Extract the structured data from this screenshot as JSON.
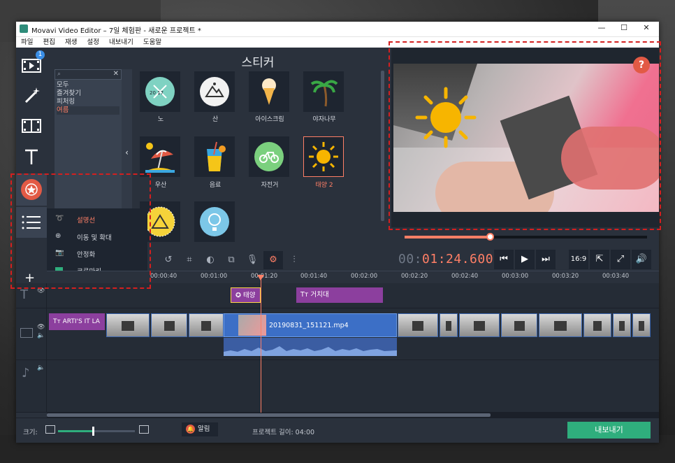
{
  "window": {
    "title": "Movavi Video Editor – 7일 체험판 - 새로운 프로젝트 *",
    "minimize": "—",
    "maximize": "☐",
    "close": "✕"
  },
  "menu": [
    "파일",
    "편집",
    "재생",
    "설정",
    "내보내기",
    "도움말"
  ],
  "tools": {
    "badge": "1"
  },
  "categories": {
    "search_placeholder": "",
    "items": [
      "모두",
      "즐겨찾기",
      "피처링",
      "여름"
    ],
    "active": "여름"
  },
  "stickers": {
    "title": "스티커",
    "items": [
      {
        "label": "노",
        "icon": "oars-badge-icon",
        "badge": "20 17"
      },
      {
        "label": "산",
        "icon": "mountain-badge-icon"
      },
      {
        "label": "아이스크림",
        "icon": "ice-cream-icon"
      },
      {
        "label": "야자나무",
        "icon": "palm-tree-icon"
      },
      {
        "label": "우산",
        "icon": "beach-umbrella-icon"
      },
      {
        "label": "음료",
        "icon": "drink-icon"
      },
      {
        "label": "자전거",
        "icon": "bicycle-icon"
      },
      {
        "label": "태양 2",
        "icon": "sun-icon",
        "selected": true
      },
      {
        "label": "",
        "icon": "tent-icon"
      },
      {
        "label": "",
        "icon": "balloon-icon"
      }
    ]
  },
  "preview": {
    "help": "?",
    "progress": 0.354
  },
  "player": {
    "time_prefix": "00:",
    "time_main": "01:24.600",
    "ratio": "16:9"
  },
  "context_menu": {
    "items": [
      {
        "label": "설명선",
        "icon": "callout-icon",
        "selected": true
      },
      {
        "label": "이동 및 확대",
        "icon": "pan-zoom-icon"
      },
      {
        "label": "안정화",
        "icon": "camera-icon"
      },
      {
        "label": "크로마키",
        "icon": "chroma-key-icon"
      }
    ]
  },
  "ruler": [
    "00:00:40",
    "00:01:00",
    "00:01:20",
    "00:01:40",
    "00:02:00",
    "00:02:20",
    "00:02:40",
    "00:03:00",
    "00:03:20",
    "00:03:40"
  ],
  "timeline": {
    "sticker_clip": "태양",
    "title_clip": "거치대",
    "text_clip": "ARTI'S IT LA",
    "video_clip": "20190831_151121.mp4"
  },
  "status": {
    "zoom_label": "크기:",
    "zoom_level": 0.46,
    "notifications": "알림",
    "project_length": "프로젝트 길이:  04:00",
    "export": "내보내기"
  },
  "colors": {
    "accent": "#ff7f66",
    "export": "#2fae7d",
    "highlight": "#d41f1f",
    "clip": "#3c6fc6",
    "title_clip": "#8c3f9e"
  }
}
